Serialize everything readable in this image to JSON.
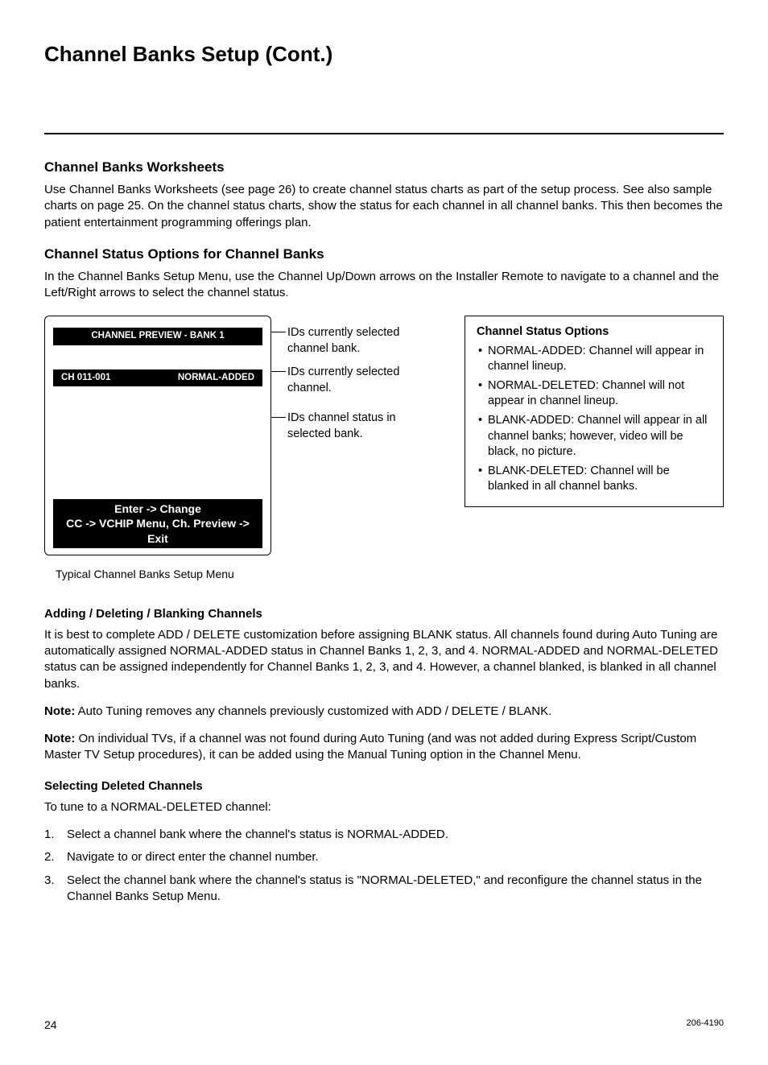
{
  "title": "Channel Banks Setup (Cont.)",
  "sections": {
    "worksheets": {
      "heading": "Channel Banks Worksheets",
      "body": "Use Channel Banks Worksheets (see page 26) to create channel status charts as part of the setup process. See also sample charts on page 25. On the channel status charts, show the status for each channel in all channel banks. This then becomes the patient entertainment programming offerings plan."
    },
    "status_options": {
      "heading": "Channel Status Options for Channel Banks",
      "body": "In the Channel Banks Setup Menu, use the Channel Up/Down arrows on the Installer Remote to navigate to a channel and the Left/Right arrows to select the channel status."
    }
  },
  "menu": {
    "title": "CHANNEL PREVIEW - BANK 1",
    "channel": "CH 011-001",
    "status": "NORMAL-ADDED",
    "footer1": "Enter -> Change",
    "footer2": "CC -> VCHIP Menu,  Ch. Preview -> Exit",
    "caption": "Typical Channel Banks Setup Menu"
  },
  "callouts": {
    "c1": "IDs currently selected channel bank.",
    "c2": "IDs currently selected channel.",
    "c3": "IDs channel status in selected bank."
  },
  "status_box": {
    "title": "Channel Status Options",
    "items": [
      "NORMAL-ADDED: Channel will appear in channel lineup.",
      "NORMAL-DELETED: Channel will not appear in channel lineup.",
      "BLANK-ADDED: Channel will appear in all channel banks; however, video will be black, no picture.",
      "BLANK-DELETED: Channel will be blanked in all channel banks."
    ]
  },
  "adding": {
    "heading": "Adding / Deleting / Blanking Channels",
    "body": "It is best to complete ADD / DELETE customization before assigning BLANK status. All channels found during Auto Tuning are automatically assigned NORMAL-ADDED status in Channel Banks 1, 2, 3, and 4. NORMAL-ADDED and NORMAL-DELETED status can be assigned independently for Channel Banks 1, 2, 3, and 4. However, a channel blanked, is blanked in all channel banks.",
    "note_label": "Note:",
    "note1": " Auto Tuning removes any channels previously customized with ADD / DELETE / BLANK.",
    "note2": " On individual TVs, if a channel was not found during Auto Tuning (and was not added during Express Script/Custom Master TV Setup procedures), it can be added using the Manual Tuning option in the Channel Menu."
  },
  "selecting": {
    "heading": "Selecting Deleted Channels",
    "intro": "To tune to a NORMAL-DELETED channel:",
    "steps": [
      "Select a channel bank where the channel's status is NORMAL-ADDED.",
      "Navigate to or direct enter the channel number.",
      "Select the channel bank where the channel's status is \"NORMAL-DELETED,\" and reconfigure the channel status in the Channel Banks Setup Menu."
    ]
  },
  "footer": {
    "page": "24",
    "doc": "206-4190"
  }
}
